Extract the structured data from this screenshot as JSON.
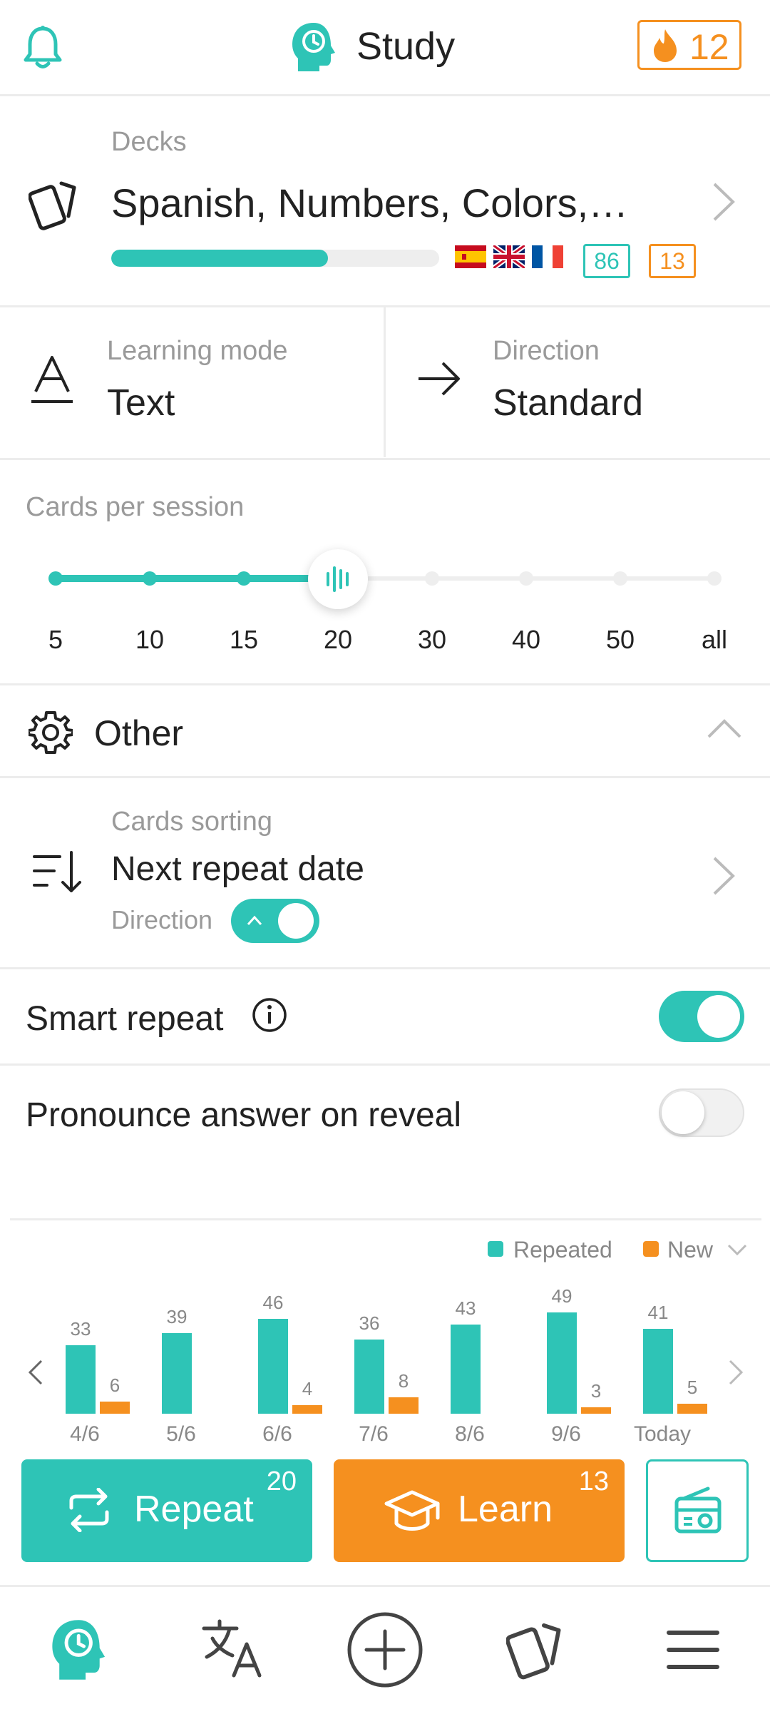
{
  "header": {
    "title": "Study",
    "streak_count": "12",
    "accent_color": "#2ec4b6",
    "streak_color": "#f5901f"
  },
  "decks": {
    "label": "Decks",
    "name": "Spanish, Numbers, Colors,…",
    "progress": 0.66,
    "flags": [
      "spain-flag-icon",
      "uk-flag-icon",
      "france-flag-icon"
    ],
    "repeat_count": "86",
    "new_count": "13"
  },
  "learning_mode": {
    "label": "Learning mode",
    "value": "Text"
  },
  "direction": {
    "label": "Direction",
    "value": "Standard"
  },
  "cards_per_session": {
    "label": "Cards per session",
    "stops": [
      "5",
      "10",
      "15",
      "20",
      "30",
      "40",
      "50",
      "all"
    ],
    "selected": "20"
  },
  "other": {
    "label": "Other"
  },
  "sorting": {
    "label": "Cards sorting",
    "value": "Next repeat date",
    "direction_label": "Direction",
    "direction_ascending": true
  },
  "smart_repeat": {
    "label": "Smart repeat",
    "enabled": true
  },
  "pronounce": {
    "label": "Pronounce answer on reveal",
    "enabled": false
  },
  "chart_data": {
    "type": "bar",
    "legend": [
      "Repeated",
      "New"
    ],
    "categories": [
      "",
      "4/6",
      "5/6",
      "6/6",
      "7/6",
      "8/6",
      "9/6",
      "Today"
    ],
    "series": [
      {
        "name": "Repeated",
        "color": "#2ec4b6",
        "values": [
          33,
          39,
          46,
          36,
          43,
          49,
          41
        ]
      },
      {
        "name": "New",
        "color": "#f5901f",
        "values": [
          6,
          0,
          4,
          8,
          0,
          3,
          5
        ]
      }
    ]
  },
  "actions": {
    "repeat_label": "Repeat",
    "repeat_count": "20",
    "learn_label": "Learn",
    "learn_count": "13"
  },
  "nav": [
    "study-icon",
    "translate-icon",
    "add-icon",
    "cards-icon",
    "menu-icon"
  ]
}
